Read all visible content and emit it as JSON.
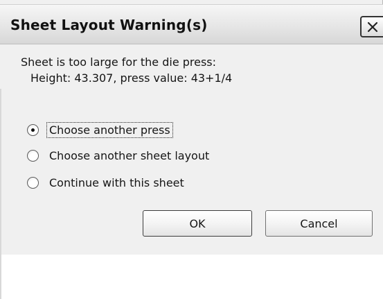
{
  "window": {
    "title": "Sheet Layout Warning(s)",
    "close_icon": "close-x-icon"
  },
  "message": {
    "line1": "Sheet is too large for the die press:",
    "line2": "Height: 43.307, press value: 43+1/4"
  },
  "options": [
    {
      "label": "Choose another press",
      "selected": true,
      "focused": true
    },
    {
      "label": "Choose another sheet layout",
      "selected": false,
      "focused": false
    },
    {
      "label": "Continue with this sheet",
      "selected": false,
      "focused": false
    }
  ],
  "buttons": {
    "ok": "OK",
    "cancel": "Cancel"
  }
}
